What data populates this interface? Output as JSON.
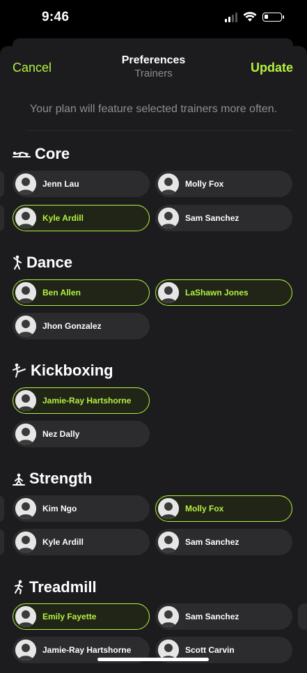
{
  "status": {
    "time": "9:46"
  },
  "nav": {
    "cancel": "Cancel",
    "title": "Preferences",
    "subtitle": "Trainers",
    "update": "Update"
  },
  "intro": "Your plan will feature selected trainers more often.",
  "sections": [
    {
      "title": "Core",
      "icon": "core-icon",
      "trainers": [
        {
          "name": "Jenn Lau",
          "selected": false
        },
        {
          "name": "Molly Fox",
          "selected": false
        },
        {
          "name": "Kyle Ardill",
          "selected": true
        },
        {
          "name": "Sam Sanchez",
          "selected": false
        }
      ]
    },
    {
      "title": "Dance",
      "icon": "dance-icon",
      "trainers": [
        {
          "name": "Ben Allen",
          "selected": true
        },
        {
          "name": "LaShawn Jones",
          "selected": true
        },
        {
          "name": "Jhon Gonzalez",
          "selected": false
        }
      ]
    },
    {
      "title": "Kickboxing",
      "icon": "kickboxing-icon",
      "trainers": [
        {
          "name": "Jamie-Ray Hartshorne",
          "selected": true
        },
        {
          "name": "Nez Dally",
          "selected": false
        }
      ]
    },
    {
      "title": "Strength",
      "icon": "strength-icon",
      "trainers": [
        {
          "name": "Kim Ngo",
          "selected": false
        },
        {
          "name": "Molly Fox",
          "selected": true
        },
        {
          "name": "Kyle Ardill",
          "selected": false
        },
        {
          "name": "Sam Sanchez",
          "selected": false
        }
      ]
    },
    {
      "title": "Treadmill",
      "icon": "treadmill-icon",
      "trainers": [
        {
          "name": "Emily Fayette",
          "selected": true
        },
        {
          "name": "Sam Sanchez",
          "selected": false
        },
        {
          "name": "Jamie-Ray Hartshorne",
          "selected": false
        },
        {
          "name": "Scott Carvin",
          "selected": false
        }
      ]
    }
  ],
  "colors": {
    "accent": "#b4f23f",
    "background": "#1c1c1e",
    "pill": "#2c2c2e"
  }
}
